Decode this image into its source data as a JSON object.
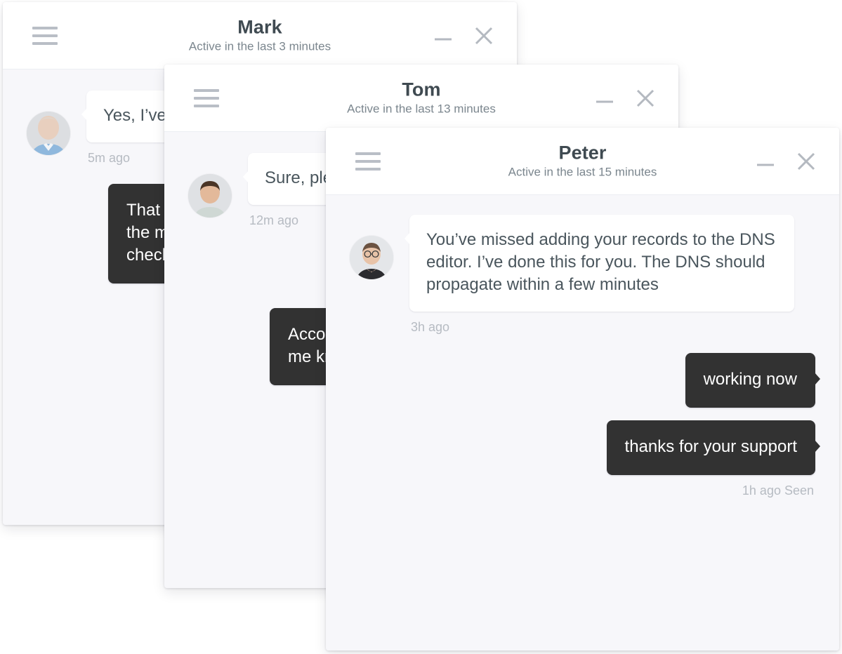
{
  "windows": [
    {
      "id": "mark",
      "peer_name": "Mark",
      "status": "Active in the last 3 minutes",
      "avatar": "bald-man-blue-shirt-avatar",
      "minimize_label": "Minimize",
      "close_label": "Close",
      "menu_label": "Menu",
      "messages": [
        {
          "direction": "incoming",
          "text": "Yes, I’ve just cleared the cache on the server",
          "time": "5m ago"
        },
        {
          "direction": "outgoing",
          "text": "That did not fix it. The pricing page still shows the mark-up from last month. Would you mind checking the product feed again?",
          "time": ""
        }
      ]
    },
    {
      "id": "tom",
      "peer_name": "Tom",
      "status": "Active in the last 13 minutes",
      "avatar": "young-man-avatar",
      "minimize_label": "Minimize",
      "close_label": "Close",
      "menu_label": "Menu",
      "messages": [
        {
          "direction": "incoming",
          "text": "Sure, please send over the details",
          "time": "12m ago"
        },
        {
          "direction": "outgoing",
          "text": "Account details are in the email I just sent, let me know if you need anything else here",
          "time": ""
        }
      ]
    },
    {
      "id": "peter",
      "peer_name": "Peter",
      "status": "Active in the last 15 minutes",
      "avatar": "man-with-glasses-avatar",
      "minimize_label": "Minimize",
      "close_label": "Close",
      "menu_label": "Menu",
      "messages": [
        {
          "direction": "incoming",
          "text": "You’ve missed adding your records to the DNS editor. I’ve done this for you. The DNS should propagate within a few minutes",
          "time": "3h ago"
        },
        {
          "direction": "outgoing",
          "text": "working now",
          "time": ""
        },
        {
          "direction": "outgoing",
          "text": "thanks for your support",
          "time": "1h ago Seen"
        }
      ]
    }
  ],
  "colors": {
    "window_background": "#f7f7fa",
    "header_background": "#ffffff",
    "incoming_bubble": "#ffffff",
    "outgoing_bubble": "#323232",
    "incoming_text": "#4a565d",
    "outgoing_text": "#ffffff",
    "peer_name_text": "#3f4a51",
    "status_text": "#7b868e",
    "timestamp_text": "#b6bbc2",
    "icon_grey": "#b9bec6"
  }
}
